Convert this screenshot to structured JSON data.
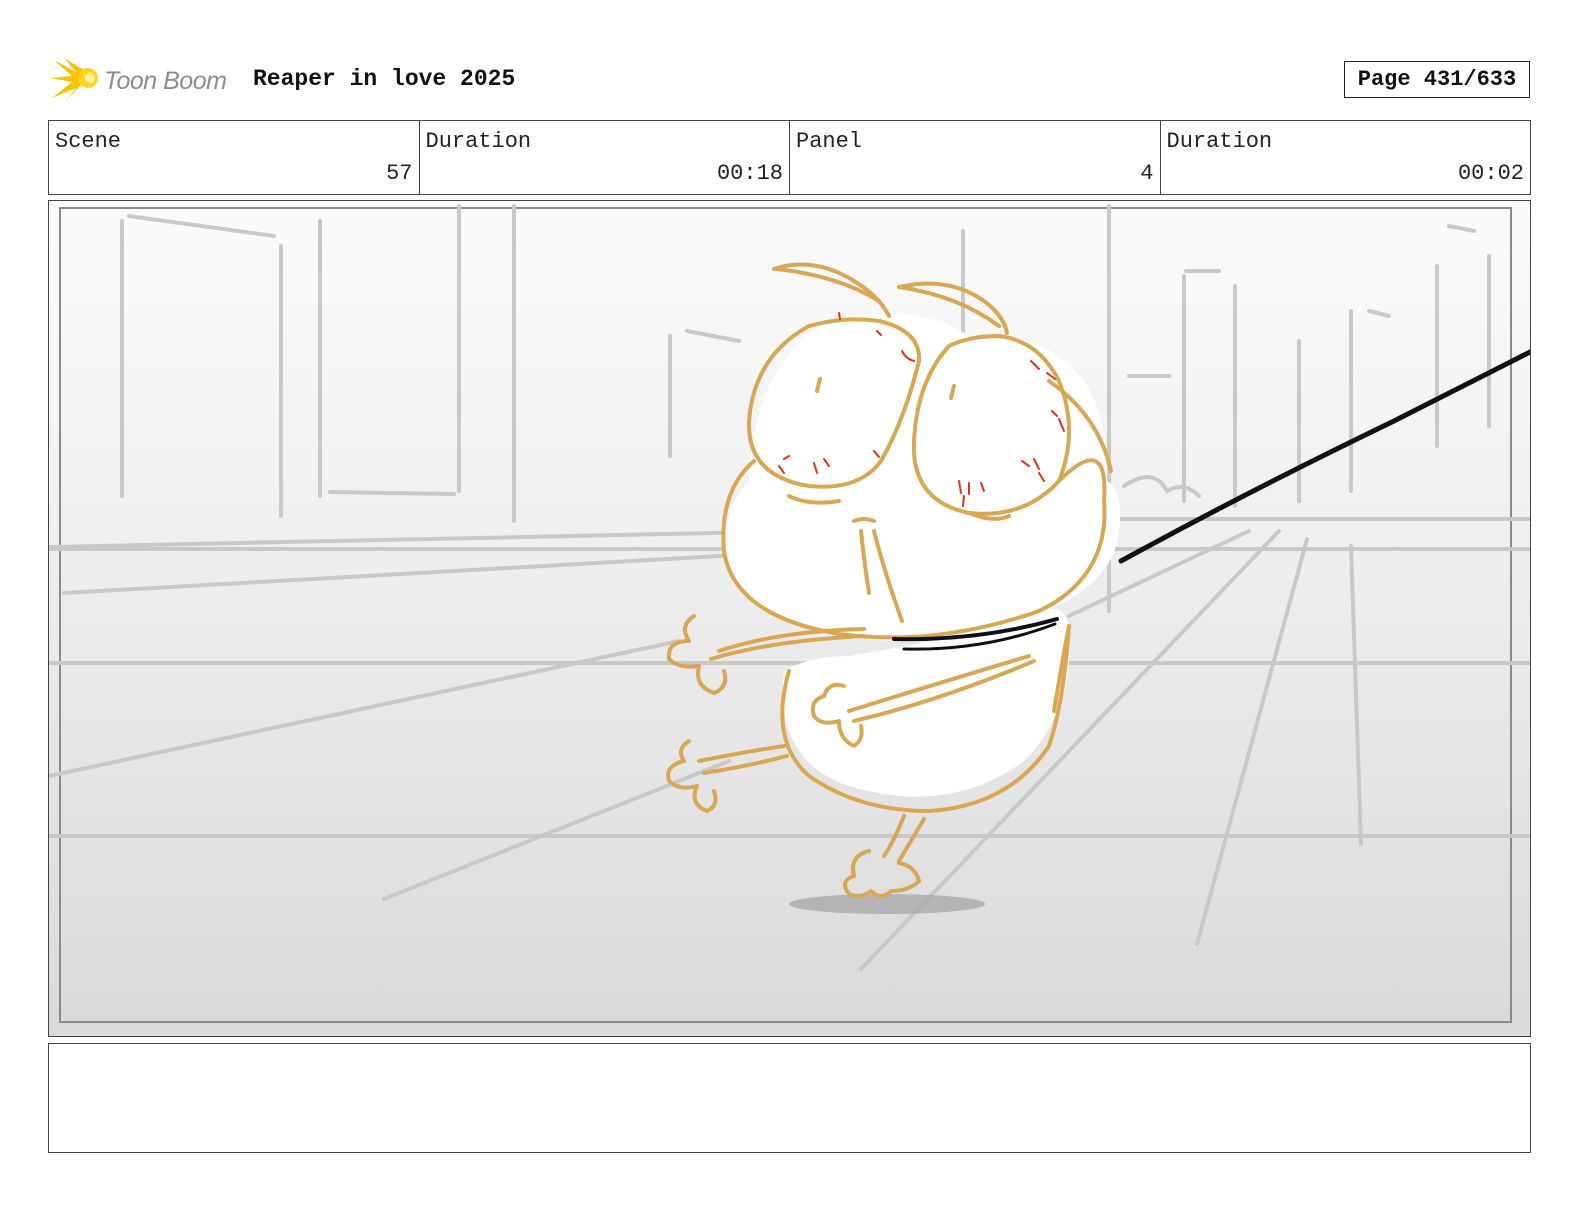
{
  "header": {
    "logo_text": "Toon Boom",
    "project_title": "Reaper in love 2025",
    "page_label": "Page 431/633"
  },
  "info": {
    "scene_label": "Scene",
    "scene_value": "57",
    "scene_duration_label": "Duration",
    "scene_duration_value": "00:18",
    "panel_label": "Panel",
    "panel_value": "4",
    "panel_duration_label": "Duration",
    "panel_duration_value": "00:02"
  },
  "notes": {
    "text": ""
  },
  "colors": {
    "character_outline": "#d9a653",
    "blush_marks": "#e0301e",
    "leash": "#111111",
    "background_lines": "#c8c8c8",
    "logo_yellow": "#f5c400"
  }
}
